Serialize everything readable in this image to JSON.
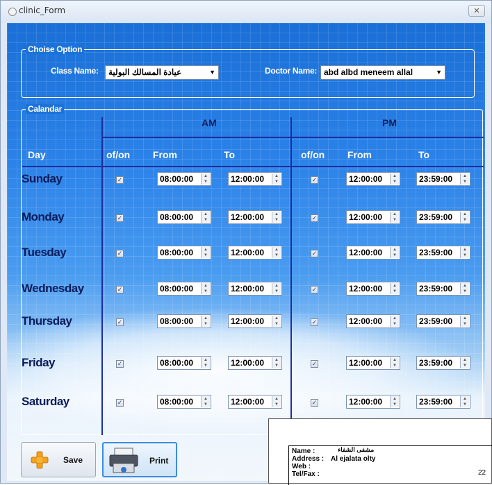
{
  "window": {
    "title": "clinic_Form",
    "close_glyph": "✕"
  },
  "choise_option": {
    "legend": "Choise Option",
    "class_label": "Class Name:",
    "class_value": "عيادة المسالك البولية",
    "doctor_label": "Doctor Name:",
    "doctor_value": "abd albd meneem allal"
  },
  "calendar": {
    "legend": "Calandar",
    "am_label": "AM",
    "pm_label": "PM",
    "columns": [
      "Day",
      "of/on",
      "From",
      "To",
      "of/on",
      "From",
      "To"
    ],
    "rows": [
      {
        "day": "Sunday",
        "am_on": true,
        "am_from": "08:00:00",
        "am_to": "12:00:00",
        "pm_on": true,
        "pm_from": "12:00:00",
        "pm_to": "23:59:00"
      },
      {
        "day": "Monday",
        "am_on": true,
        "am_from": "08:00:00",
        "am_to": "12:00:00",
        "pm_on": true,
        "pm_from": "12:00:00",
        "pm_to": "23:59:00"
      },
      {
        "day": "Tuesday",
        "am_on": true,
        "am_from": "08:00:00",
        "am_to": "12:00:00",
        "pm_on": true,
        "pm_from": "12:00:00",
        "pm_to": "23:59:00"
      },
      {
        "day": "Wednesday",
        "am_on": true,
        "am_from": "08:00:00",
        "am_to": "12:00:00",
        "pm_on": true,
        "pm_from": "12:00:00",
        "pm_to": "23:59:00"
      },
      {
        "day": "Thursday",
        "am_on": true,
        "am_from": "08:00:00",
        "am_to": "12:00:00",
        "pm_on": true,
        "pm_from": "12:00:00",
        "pm_to": "23:59:00"
      },
      {
        "day": "Friday",
        "am_on": true,
        "am_from": "08:00:00",
        "am_to": "12:00:00",
        "pm_on": true,
        "pm_from": "12:00:00",
        "pm_to": "23:59:00"
      },
      {
        "day": "Saturday",
        "am_on": true,
        "am_from": "08:00:00",
        "am_to": "12:00:00",
        "pm_on": true,
        "pm_from": "12:00:00",
        "pm_to": "23:59:00"
      }
    ]
  },
  "buttons": {
    "save": "Save",
    "print": "Print"
  },
  "report": {
    "name_label": "Name :",
    "name_value": "مشفى الشفاء",
    "address_label": "Address :",
    "address_value": "Al ejalata olty",
    "web_label": "Web :",
    "tel_label": "Tel/Fax :",
    "page_number": "22"
  },
  "colors": {
    "accent": "#1c2fa0",
    "sky": "#2b82e8"
  }
}
